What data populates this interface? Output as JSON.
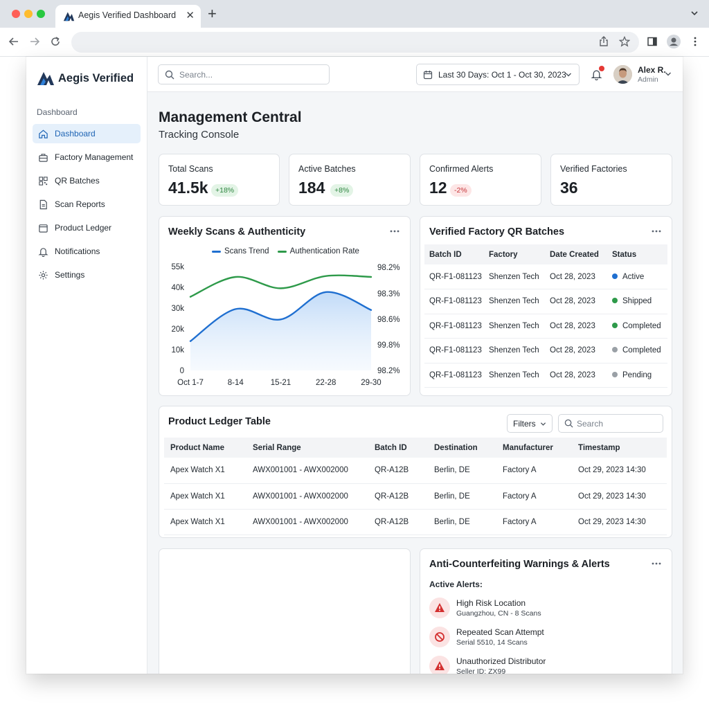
{
  "browser": {
    "tab_title": "Aegis Verified Dashboard",
    "tab_close": "✕",
    "new_tab": "+"
  },
  "app": {
    "brand": "Aegis Verified",
    "sidebar": {
      "heading": "Dashboard",
      "items": [
        {
          "label": "Dashboard",
          "icon": "home-icon",
          "active": true
        },
        {
          "label": "Factory Management",
          "icon": "factory-icon"
        },
        {
          "label": "QR Batches",
          "icon": "qr-icon"
        },
        {
          "label": "Scan Reports",
          "icon": "report-icon"
        },
        {
          "label": "Product Ledger",
          "icon": "ledger-icon"
        },
        {
          "label": "Notifications",
          "icon": "bell-icon"
        },
        {
          "label": "Settings",
          "icon": "gear-icon"
        }
      ]
    },
    "topbar": {
      "search_placeholder": "Search...",
      "date_range": "Last 30 Days: Oct 1 - Oct 30, 2023",
      "user_name": "Alex R.",
      "user_role": "Admin"
    },
    "page_title": "Management Central",
    "page_subtitle": "Tracking Console",
    "stats": [
      {
        "label": "Total Scans",
        "value": "41.5k",
        "change": "+18%",
        "trend": "up"
      },
      {
        "label": "Active Batches",
        "value": "184",
        "change": "+8%",
        "trend": "up"
      },
      {
        "label": "Confirmed Alerts",
        "value": "12",
        "change": "-2%",
        "trend": "down"
      },
      {
        "label": "Verified Factories",
        "value": "36"
      }
    ],
    "chart_card": {
      "title": "Weekly Scans & Authenticity"
    },
    "qr_batches": {
      "title": "Verified Factory QR Batches",
      "columns": [
        "Batch ID",
        "Factory",
        "Date Created",
        "Status"
      ],
      "rows": [
        {
          "batch": "QR-F1-081123",
          "factory": "Shenzen Tech",
          "date": "Oct 28, 2023",
          "status": "Active",
          "color": "#1f6fd0"
        },
        {
          "batch": "QR-F1-081123",
          "factory": "Shenzen Tech",
          "date": "Oct 28, 2023",
          "status": "Shipped",
          "color": "#2e9a4a"
        },
        {
          "batch": "QR-F1-081123",
          "factory": "Shenzen Tech",
          "date": "Oct 28, 2023",
          "status": "Completed",
          "color": "#2e9a4a"
        },
        {
          "batch": "QR-F1-081123",
          "factory": "Shenzen Tech",
          "date": "Oct 28, 2023",
          "status": "Completed",
          "color": "#9aa0a6"
        },
        {
          "batch": "QR-F1-081123",
          "factory": "Shenzen Tech",
          "date": "Oct 28, 2023",
          "status": "Pending",
          "color": "#9aa0a6"
        }
      ]
    },
    "ledger": {
      "title": "Product Ledger Table",
      "filters_label": "Filters",
      "search_placeholder": "Search",
      "columns": [
        "Product Name",
        "Serial Range",
        "Batch ID",
        "Destination",
        "Manufacturer",
        "Timestamp"
      ],
      "rows": [
        {
          "product": "Apex Watch X1",
          "serial": "AWX001001 - AWX002000",
          "batch": "QR-A12B",
          "destination": "Berlin, DE",
          "manufacturer": "Factory A",
          "timestamp": "Oct 29, 2023 14:30"
        },
        {
          "product": "Apex Watch X1",
          "serial": "AWX001001 - AWX002000",
          "batch": "QR-A12B",
          "destination": "Berlin, DE",
          "manufacturer": "Factory A",
          "timestamp": "Oct 29, 2023 14:30"
        },
        {
          "product": "Apex Watch X1",
          "serial": "AWX001001 - AWX002000",
          "batch": "QR-A12B",
          "destination": "Berlin, DE",
          "manufacturer": "Factory A",
          "timestamp": "Oct 29, 2023 14:30"
        }
      ]
    },
    "alerts": {
      "title": "Anti-Counterfeiting Warnings & Alerts",
      "heading": "Active Alerts:",
      "items": [
        {
          "title": "High Risk Location",
          "subtitle": "Guangzhou, CN - 8 Scans",
          "icon": "warning-triangle-icon"
        },
        {
          "title": "Repeated Scan Attempt",
          "subtitle": "Serial 5510, 14 Scans",
          "icon": "blocked-icon"
        },
        {
          "title": "Unauthorized Distributor",
          "subtitle": "Seller ID: ZX99",
          "icon": "warning-triangle-icon"
        }
      ]
    }
  },
  "chart_data": {
    "type": "line",
    "title": "Weekly Scans & Authenticity",
    "categories": [
      "Oct 1-7",
      "8-14",
      "15-21",
      "22-28",
      "29-30"
    ],
    "series": [
      {
        "name": "Scans Trend",
        "axis": "left",
        "color": "#1f6fd0",
        "values": [
          15500,
          32500,
          27000,
          41500,
          32000
        ]
      },
      {
        "name": "Authentication Rate",
        "axis": "right",
        "color": "#2e9a4a",
        "values": [
          39000,
          49500,
          43500,
          50000,
          49500
        ]
      }
    ],
    "left_axis": {
      "ticks": [
        "0",
        "10k",
        "20k",
        "30k",
        "40k",
        "55k"
      ],
      "ylim": [
        0,
        55000
      ]
    },
    "right_axis": {
      "ticks": [
        "98.2%",
        "98.3%",
        "98.6%",
        "99.8%",
        "98.2%"
      ]
    },
    "legend_position": "top",
    "grid": false
  }
}
